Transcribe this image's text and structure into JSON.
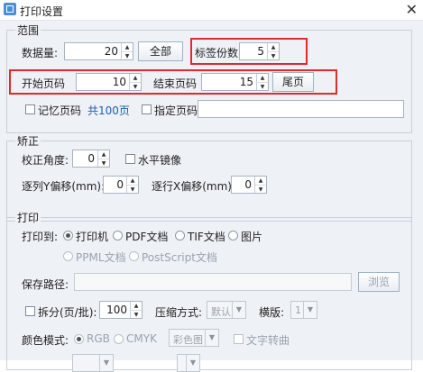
{
  "window": {
    "title": "打印设置",
    "close_glyph": "✕"
  },
  "range": {
    "group_title": "范围",
    "data_count_label": "数据量:",
    "data_count_value": "20",
    "all_button": "全部",
    "label_count_label": "标签份数:",
    "label_count_value": "5",
    "start_page_label": "开始页码",
    "start_page_value": "10",
    "end_page_label": "结束页码",
    "end_page_value": "15",
    "last_page_button": "尾页",
    "remember_page_label": "记忆页码",
    "total_pages_text": "共100页",
    "specify_page_label": "指定页码"
  },
  "correction": {
    "group_title": "矫正",
    "angle_label": "校正角度:",
    "angle_value": "0",
    "mirror_label": "水平镜像",
    "row_y_label": "逐列Y偏移(mm):",
    "row_y_value": "0",
    "row_x_label": "逐行X偏移(mm):",
    "row_x_value": "0"
  },
  "print": {
    "group_title": "打印",
    "print_to_label": "打印到:",
    "targets": [
      "打印机",
      "PDF文档",
      "TIF文档",
      "图片"
    ],
    "targets_row2": [
      "PPML文档",
      "PostScript文档"
    ],
    "save_path_label": "保存路径:",
    "browse_button": "浏览",
    "split_label": "拆分(页/批):",
    "split_value": "100",
    "compression_label": "压缩方式:",
    "compression_value": "默认",
    "layout_label": "横版:",
    "layout_value": "1",
    "color_mode_label": "颜色模式:",
    "color_rgb": "RGB",
    "color_cmyk": "CMYK",
    "color_select": "彩色图",
    "text_convert_label": "文字转曲"
  }
}
